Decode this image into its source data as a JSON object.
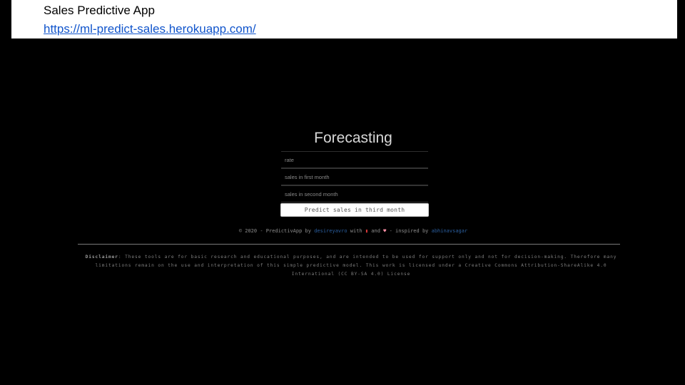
{
  "header": {
    "title": "Sales Predictive App",
    "link": "https://ml-predict-sales.herokuapp.com/"
  },
  "app": {
    "title": "Forecasting",
    "fields": [
      {
        "placeholder": "rate"
      },
      {
        "placeholder": "sales in first month"
      },
      {
        "placeholder": "sales in second month"
      }
    ],
    "button_label": "Predict sales in third month"
  },
  "footer": {
    "prefix": "© 2020 - PredictivApp by",
    "author": "desireyavro",
    "with": "with",
    "and": "and",
    "inspired": "- inspired by",
    "inspirer": "abhinavsagar",
    "disclaimer_label": "Disclaimer",
    "disclaimer_text": ": These tools are for basic research and educational purposes, and are intended to be used for support only and not for decision-making. Therefore many limitations remain on the use and interpretation of this simple predictive model. This work is licensed under a Creative Commons Attribution-ShareAlike 4.0 International (CC BY-SA 4.0) License"
  },
  "icons": {
    "book": "book-icon",
    "heart": "heart-icon"
  },
  "colors": {
    "background": "#000000",
    "link": "#1155cc",
    "footer_link": "#2b5e9e"
  }
}
